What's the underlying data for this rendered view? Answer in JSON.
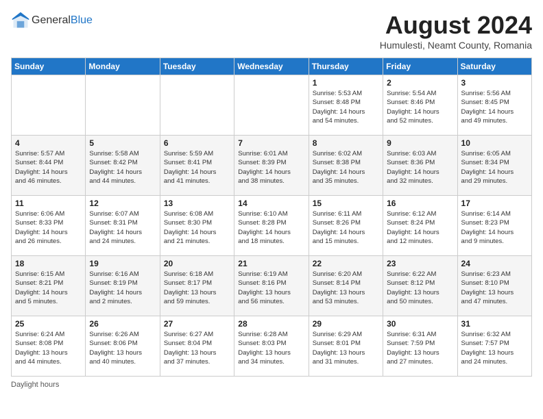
{
  "header": {
    "logo_general": "General",
    "logo_blue": "Blue",
    "month_year": "August 2024",
    "location": "Humulesti, Neamt County, Romania"
  },
  "days_of_week": [
    "Sunday",
    "Monday",
    "Tuesday",
    "Wednesday",
    "Thursday",
    "Friday",
    "Saturday"
  ],
  "footer": {
    "note": "Daylight hours"
  },
  "weeks": [
    [
      {
        "day": "",
        "info": ""
      },
      {
        "day": "",
        "info": ""
      },
      {
        "day": "",
        "info": ""
      },
      {
        "day": "",
        "info": ""
      },
      {
        "day": "1",
        "info": "Sunrise: 5:53 AM\nSunset: 8:48 PM\nDaylight: 14 hours\nand 54 minutes."
      },
      {
        "day": "2",
        "info": "Sunrise: 5:54 AM\nSunset: 8:46 PM\nDaylight: 14 hours\nand 52 minutes."
      },
      {
        "day": "3",
        "info": "Sunrise: 5:56 AM\nSunset: 8:45 PM\nDaylight: 14 hours\nand 49 minutes."
      }
    ],
    [
      {
        "day": "4",
        "info": "Sunrise: 5:57 AM\nSunset: 8:44 PM\nDaylight: 14 hours\nand 46 minutes."
      },
      {
        "day": "5",
        "info": "Sunrise: 5:58 AM\nSunset: 8:42 PM\nDaylight: 14 hours\nand 44 minutes."
      },
      {
        "day": "6",
        "info": "Sunrise: 5:59 AM\nSunset: 8:41 PM\nDaylight: 14 hours\nand 41 minutes."
      },
      {
        "day": "7",
        "info": "Sunrise: 6:01 AM\nSunset: 8:39 PM\nDaylight: 14 hours\nand 38 minutes."
      },
      {
        "day": "8",
        "info": "Sunrise: 6:02 AM\nSunset: 8:38 PM\nDaylight: 14 hours\nand 35 minutes."
      },
      {
        "day": "9",
        "info": "Sunrise: 6:03 AM\nSunset: 8:36 PM\nDaylight: 14 hours\nand 32 minutes."
      },
      {
        "day": "10",
        "info": "Sunrise: 6:05 AM\nSunset: 8:34 PM\nDaylight: 14 hours\nand 29 minutes."
      }
    ],
    [
      {
        "day": "11",
        "info": "Sunrise: 6:06 AM\nSunset: 8:33 PM\nDaylight: 14 hours\nand 26 minutes."
      },
      {
        "day": "12",
        "info": "Sunrise: 6:07 AM\nSunset: 8:31 PM\nDaylight: 14 hours\nand 24 minutes."
      },
      {
        "day": "13",
        "info": "Sunrise: 6:08 AM\nSunset: 8:30 PM\nDaylight: 14 hours\nand 21 minutes."
      },
      {
        "day": "14",
        "info": "Sunrise: 6:10 AM\nSunset: 8:28 PM\nDaylight: 14 hours\nand 18 minutes."
      },
      {
        "day": "15",
        "info": "Sunrise: 6:11 AM\nSunset: 8:26 PM\nDaylight: 14 hours\nand 15 minutes."
      },
      {
        "day": "16",
        "info": "Sunrise: 6:12 AM\nSunset: 8:24 PM\nDaylight: 14 hours\nand 12 minutes."
      },
      {
        "day": "17",
        "info": "Sunrise: 6:14 AM\nSunset: 8:23 PM\nDaylight: 14 hours\nand 9 minutes."
      }
    ],
    [
      {
        "day": "18",
        "info": "Sunrise: 6:15 AM\nSunset: 8:21 PM\nDaylight: 14 hours\nand 5 minutes."
      },
      {
        "day": "19",
        "info": "Sunrise: 6:16 AM\nSunset: 8:19 PM\nDaylight: 14 hours\nand 2 minutes."
      },
      {
        "day": "20",
        "info": "Sunrise: 6:18 AM\nSunset: 8:17 PM\nDaylight: 13 hours\nand 59 minutes."
      },
      {
        "day": "21",
        "info": "Sunrise: 6:19 AM\nSunset: 8:16 PM\nDaylight: 13 hours\nand 56 minutes."
      },
      {
        "day": "22",
        "info": "Sunrise: 6:20 AM\nSunset: 8:14 PM\nDaylight: 13 hours\nand 53 minutes."
      },
      {
        "day": "23",
        "info": "Sunrise: 6:22 AM\nSunset: 8:12 PM\nDaylight: 13 hours\nand 50 minutes."
      },
      {
        "day": "24",
        "info": "Sunrise: 6:23 AM\nSunset: 8:10 PM\nDaylight: 13 hours\nand 47 minutes."
      }
    ],
    [
      {
        "day": "25",
        "info": "Sunrise: 6:24 AM\nSunset: 8:08 PM\nDaylight: 13 hours\nand 44 minutes."
      },
      {
        "day": "26",
        "info": "Sunrise: 6:26 AM\nSunset: 8:06 PM\nDaylight: 13 hours\nand 40 minutes."
      },
      {
        "day": "27",
        "info": "Sunrise: 6:27 AM\nSunset: 8:04 PM\nDaylight: 13 hours\nand 37 minutes."
      },
      {
        "day": "28",
        "info": "Sunrise: 6:28 AM\nSunset: 8:03 PM\nDaylight: 13 hours\nand 34 minutes."
      },
      {
        "day": "29",
        "info": "Sunrise: 6:29 AM\nSunset: 8:01 PM\nDaylight: 13 hours\nand 31 minutes."
      },
      {
        "day": "30",
        "info": "Sunrise: 6:31 AM\nSunset: 7:59 PM\nDaylight: 13 hours\nand 27 minutes."
      },
      {
        "day": "31",
        "info": "Sunrise: 6:32 AM\nSunset: 7:57 PM\nDaylight: 13 hours\nand 24 minutes."
      }
    ]
  ]
}
